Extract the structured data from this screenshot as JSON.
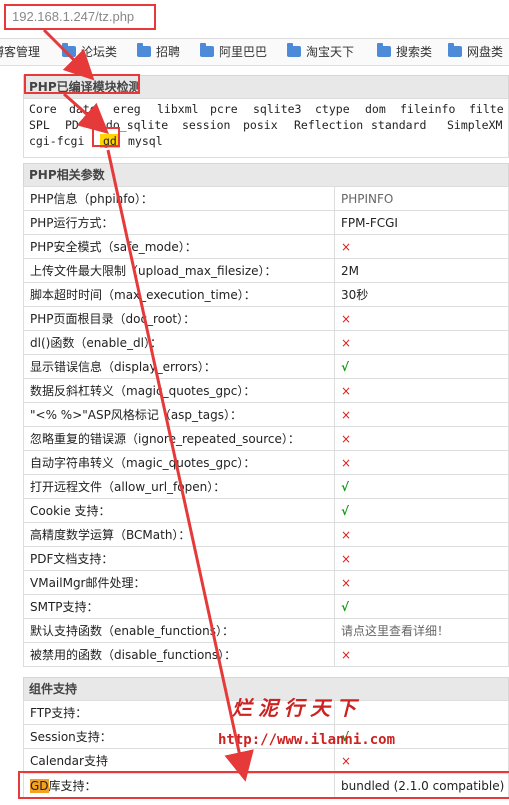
{
  "address_bar": {
    "url": "192.168.1.247/tz.php"
  },
  "bookmarks": [
    {
      "label": "博客管理",
      "icon": "folder-icon",
      "partial": true
    },
    {
      "label": "论坛类",
      "icon": "folder-icon"
    },
    {
      "label": "招聘",
      "icon": "folder-icon"
    },
    {
      "label": "阿里巴巴",
      "icon": "folder-icon"
    },
    {
      "label": "淘宝天下",
      "icon": "folder-icon"
    },
    {
      "label": "搜索类",
      "icon": "folder-icon"
    },
    {
      "label": "网盘类",
      "icon": "folder-icon"
    }
  ],
  "compiled_modules": {
    "title": "PHP已编译模块检测",
    "lines": [
      [
        "Core",
        "date",
        "ereg",
        "libxml",
        "pcre",
        "sqlite3",
        "ctype",
        "dom",
        "fileinfo",
        "filte"
      ],
      [
        "SPL",
        "PD",
        "pdo_sqlite",
        "session",
        "posix",
        "Reflection",
        "standard",
        "SimpleXM"
      ],
      [
        "cgi-fcgi",
        "gd",
        "mysql"
      ]
    ]
  },
  "php_params": {
    "title": "PHP相关参数",
    "rows": [
      {
        "label": "PHP信息（phpinfo）：",
        "value": "PHPINFO",
        "style": "grey"
      },
      {
        "label": "PHP运行方式：",
        "value": "FPM-FCGI",
        "style": "plain"
      },
      {
        "label": "PHP安全模式（safe_mode）：",
        "value": "×",
        "style": "no"
      },
      {
        "label": "上传文件最大限制（upload_max_filesize）：",
        "value": "2M",
        "style": "plain"
      },
      {
        "label": "脚本超时时间（max_execution_time）：",
        "value": "30秒",
        "style": "plain"
      },
      {
        "label": "PHP页面根目录（doc_root）：",
        "value": "×",
        "style": "no"
      },
      {
        "label": "dl()函数（enable_dl）：",
        "value": "×",
        "style": "no"
      },
      {
        "label": "显示错误信息（display_errors）：",
        "value": "√",
        "style": "yes"
      },
      {
        "label": "数据反斜杠转义（magic_quotes_gpc）：",
        "value": "×",
        "style": "no"
      },
      {
        "label": "\"<% %>\"ASP风格标记（asp_tags）：",
        "value": "×",
        "style": "no"
      },
      {
        "label": "忽略重复的错误源（ignore_repeated_source）：",
        "value": "×",
        "style": "no"
      },
      {
        "label": "自动字符串转义（magic_quotes_gpc）：",
        "value": "×",
        "style": "no"
      },
      {
        "label": "打开远程文件（allow_url_fopen）：",
        "value": "√",
        "style": "yes"
      },
      {
        "label": "Cookie 支持：",
        "value": "√",
        "style": "yes"
      },
      {
        "label": "高精度数学运算（BCMath）：",
        "value": "×",
        "style": "no"
      },
      {
        "label": "PDF文档支持：",
        "value": "×",
        "style": "no"
      },
      {
        "label": "VMailMgr邮件处理：",
        "value": "×",
        "style": "no"
      },
      {
        "label": "SMTP支持：",
        "value": "√",
        "style": "yes"
      },
      {
        "label": "默认支持函数（enable_functions）：",
        "value": "请点这里查看详细！",
        "style": "grey"
      },
      {
        "label": "被禁用的函数（disable_functions）：",
        "value": "×",
        "style": "no"
      }
    ]
  },
  "components": {
    "title": "组件支持",
    "rows": [
      {
        "label": "FTP支持：",
        "value": "",
        "style": "plain"
      },
      {
        "label": "Session支持：",
        "value": "√",
        "style": "yes"
      },
      {
        "label": "Calendar支持",
        "value": "×",
        "style": "no"
      }
    ],
    "gd_row": {
      "label_hl": "GD",
      "label_rest": "库支持：",
      "value": "bundled (2.1.0 compatible)"
    }
  },
  "watermark": {
    "text": "烂泥行天下",
    "url": "http://www.ilanni.com"
  },
  "colors": {
    "annotation_red": "#e63a3a",
    "gd_highlight": "#ffd400",
    "gd_row_highlight": "#f4a020",
    "no_mark": "#e02020",
    "yes_mark": "#119911"
  }
}
